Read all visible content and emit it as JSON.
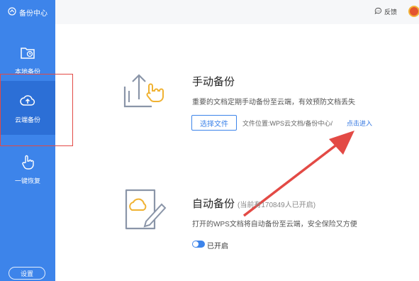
{
  "sidebar": {
    "brand": "备份中心",
    "items": [
      {
        "label": "本地备份",
        "icon": "folder-clock-icon"
      },
      {
        "label": "云端备份",
        "icon": "cloud-upload-icon"
      },
      {
        "label": "一键恢复",
        "icon": "hand-pointer-icon"
      }
    ],
    "settings_label": "设置"
  },
  "topbar": {
    "feedback_label": "反馈"
  },
  "manual": {
    "title": "手动备份",
    "desc": "重要的文档定期手动备份至云端，有效预防文档丢失",
    "choose_label": "选择文件",
    "location": "文件位置:WPS云文档/备份中心/",
    "enter_label": "点击进入"
  },
  "auto": {
    "title": "自动备份",
    "subtitle": "(当前有170849人已开启)",
    "desc": "打开的WPS文档将自动备份至云端，安全保险又方便",
    "status": "已开启",
    "enabled": true
  },
  "colors": {
    "sidebar": "#3d84ea",
    "sidebar_active": "#2c6fd6",
    "accent": "#3d84ea",
    "annotation": "#e34a45"
  }
}
